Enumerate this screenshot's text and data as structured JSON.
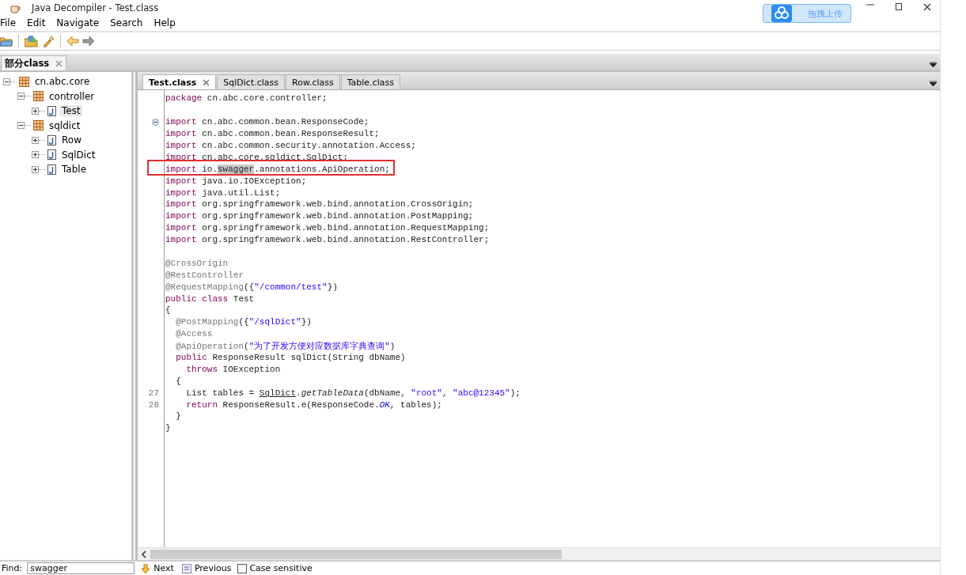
{
  "window": {
    "title": "Java Decompiler - Test.class"
  },
  "upload_widget": {
    "label": "拖拽上传"
  },
  "menu": [
    {
      "label": "File"
    },
    {
      "label": "Edit"
    },
    {
      "label": "Navigate"
    },
    {
      "label": "Search"
    },
    {
      "label": "Help"
    }
  ],
  "file_tabs": [
    {
      "label": "部分class",
      "selected": true
    }
  ],
  "tree": [
    {
      "label": "cn.abc.core",
      "kind": "package",
      "expanded": true,
      "selected": false,
      "children": [
        {
          "label": "controller",
          "kind": "package",
          "expanded": true,
          "selected": false,
          "children": [
            {
              "label": "Test",
              "kind": "class",
              "expanded": false,
              "selected": true
            }
          ]
        },
        {
          "label": "sqldict",
          "kind": "package",
          "expanded": true,
          "selected": false,
          "children": [
            {
              "label": "Row",
              "kind": "class",
              "expanded": false,
              "selected": false
            },
            {
              "label": "SqlDict",
              "kind": "class",
              "expanded": false,
              "selected": false
            },
            {
              "label": "Table",
              "kind": "class",
              "expanded": false,
              "selected": false
            }
          ]
        }
      ]
    }
  ],
  "editor_tabs": [
    {
      "label": "Test.class",
      "selected": true
    },
    {
      "label": "SqlDict.class",
      "selected": false
    },
    {
      "label": "Row.class",
      "selected": false
    },
    {
      "label": "Table.class",
      "selected": false
    }
  ],
  "code": [
    {
      "tokens": [
        {
          "kind": "kw",
          "text": "package"
        },
        {
          "kind": "plain",
          "text": " cn.abc.core.controller;"
        }
      ]
    },
    {
      "blank_before": true,
      "fold": true,
      "tokens": [
        {
          "kind": "kw",
          "text": "import"
        },
        {
          "kind": "plain",
          "text": " cn.abc.common.bean.ResponseCode;"
        }
      ]
    },
    {
      "tokens": [
        {
          "kind": "kw",
          "text": "import"
        },
        {
          "kind": "plain",
          "text": " cn.abc.common.bean.ResponseResult;"
        }
      ]
    },
    {
      "tokens": [
        {
          "kind": "kw",
          "text": "import"
        },
        {
          "kind": "plain",
          "text": " cn.abc.common.security.annotation.Access;"
        }
      ]
    },
    {
      "tokens": [
        {
          "kind": "kw",
          "text": "import"
        },
        {
          "kind": "plain",
          "text": " cn.abc.core.sqldict.SqlDict;"
        }
      ]
    },
    {
      "marked": true,
      "tokens": [
        {
          "kind": "kw",
          "text": "import"
        },
        {
          "kind": "plain",
          "text": " io."
        },
        {
          "kind": "match",
          "text": "swagger"
        },
        {
          "kind": "plain",
          "text": ".annotations.ApiOperation;"
        }
      ]
    },
    {
      "tokens": [
        {
          "kind": "kw",
          "text": "import"
        },
        {
          "kind": "plain",
          "text": " java.io.IOException;"
        }
      ]
    },
    {
      "tokens": [
        {
          "kind": "kw",
          "text": "import"
        },
        {
          "kind": "plain",
          "text": " java.util.List;"
        }
      ]
    },
    {
      "tokens": [
        {
          "kind": "kw",
          "text": "import"
        },
        {
          "kind": "plain",
          "text": " org.springframework.web.bind.annotation.CrossOrigin;"
        }
      ]
    },
    {
      "tokens": [
        {
          "kind": "kw",
          "text": "import"
        },
        {
          "kind": "plain",
          "text": " org.springframework.web.bind.annotation.PostMapping;"
        }
      ]
    },
    {
      "tokens": [
        {
          "kind": "kw",
          "text": "import"
        },
        {
          "kind": "plain",
          "text": " org.springframework.web.bind.annotation.RequestMapping;"
        }
      ]
    },
    {
      "tokens": [
        {
          "kind": "kw",
          "text": "import"
        },
        {
          "kind": "plain",
          "text": " org.springframework.web.bind.annotation.RestController;"
        }
      ]
    },
    {
      "blank_before": true,
      "tokens": [
        {
          "kind": "ann",
          "text": "@CrossOrigin"
        }
      ]
    },
    {
      "tokens": [
        {
          "kind": "ann",
          "text": "@RestController"
        }
      ]
    },
    {
      "tokens": [
        {
          "kind": "ann",
          "text": "@RequestMapping"
        },
        {
          "kind": "plain",
          "text": "({"
        },
        {
          "kind": "str",
          "text": "\"/common/test\""
        },
        {
          "kind": "plain",
          "text": "})"
        }
      ]
    },
    {
      "tokens": [
        {
          "kind": "kw",
          "text": "public class"
        },
        {
          "kind": "plain",
          "text": " Test"
        }
      ]
    },
    {
      "tokens": [
        {
          "kind": "plain",
          "text": "{"
        }
      ]
    },
    {
      "tokens": [
        {
          "kind": "ann",
          "text": "  @PostMapping"
        },
        {
          "kind": "plain",
          "text": "({"
        },
        {
          "kind": "str",
          "text": "\"/sqlDict\""
        },
        {
          "kind": "plain",
          "text": "})"
        }
      ]
    },
    {
      "tokens": [
        {
          "kind": "ann",
          "text": "  @Access"
        }
      ]
    },
    {
      "tokens": [
        {
          "kind": "ann",
          "text": "  @ApiOperation"
        },
        {
          "kind": "plain",
          "text": "("
        },
        {
          "kind": "str",
          "text": "\"为了开发方便对应数据库字典查询\""
        },
        {
          "kind": "plain",
          "text": ")"
        }
      ]
    },
    {
      "tokens": [
        {
          "kind": "kw",
          "text": "  public"
        },
        {
          "kind": "plain",
          "text": " ResponseResult sqlDict(String dbName)"
        }
      ]
    },
    {
      "tokens": [
        {
          "kind": "kw",
          "text": "    throws"
        },
        {
          "kind": "plain",
          "text": " IOException"
        }
      ]
    },
    {
      "tokens": [
        {
          "kind": "plain",
          "text": "  {"
        }
      ]
    },
    {
      "number": "27",
      "tokens": [
        {
          "kind": "plain",
          "text": "    List tables = "
        },
        {
          "kind": "link",
          "text": "SqlDict"
        },
        {
          "kind": "plain",
          "text": "."
        },
        {
          "kind": "italic",
          "text": "getTableData"
        },
        {
          "kind": "plain",
          "text": "(dbName, "
        },
        {
          "kind": "str",
          "text": "\"root\""
        },
        {
          "kind": "plain",
          "text": ", "
        },
        {
          "kind": "str",
          "text": "\"abc@12345\""
        },
        {
          "kind": "plain",
          "text": ");"
        }
      ]
    },
    {
      "number": "28",
      "tokens": [
        {
          "kind": "kw",
          "text": "    return"
        },
        {
          "kind": "plain",
          "text": " ResponseResult.e(ResponseCode."
        },
        {
          "kind": "const",
          "text": "OK"
        },
        {
          "kind": "plain",
          "text": ", tables);"
        }
      ]
    },
    {
      "tokens": [
        {
          "kind": "plain",
          "text": "  }"
        }
      ]
    },
    {
      "tokens": [
        {
          "kind": "plain",
          "text": "}"
        }
      ]
    }
  ],
  "find_bar": {
    "label": "Find:",
    "value": "swagger",
    "next": "Next",
    "previous": "Previous",
    "case_sensitive": {
      "label": "Case sensitive",
      "checked": false
    }
  }
}
